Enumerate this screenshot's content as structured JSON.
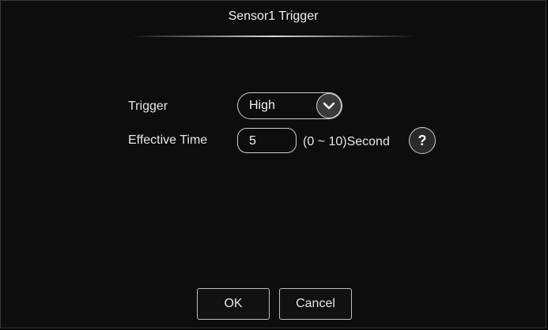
{
  "dialog": {
    "title": "Sensor1 Trigger"
  },
  "form": {
    "trigger_label": "Trigger",
    "trigger_value": "High",
    "effective_time_label": "Effective Time",
    "effective_time_value": "5",
    "effective_time_unit": "(0 ~ 10)Second",
    "help_symbol": "?"
  },
  "buttons": {
    "ok_label": "OK",
    "cancel_label": "Cancel"
  },
  "icons": {
    "dropdown": "chevron-down-icon",
    "help": "help-icon"
  },
  "colors": {
    "background": "#0d0d0d",
    "text": "#e6e6e6",
    "border": "#d0d0d0",
    "chevron_bg": "#3a3a3a"
  }
}
